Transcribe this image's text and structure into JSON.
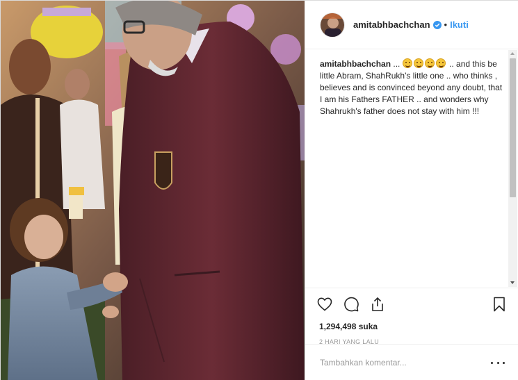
{
  "post": {
    "username": "amitabhbachchan",
    "verified": true,
    "follow_separator": "•",
    "follow_label": "Ikuti",
    "caption_user": "amitabhbachchan",
    "caption_prefix": " ... ",
    "caption_emoji_count": 4,
    "caption_text": " .. and this be little Abram, ShahRukh's little one .. who thinks , believes and is convinced beyond any doubt, that I am his Fathers FATHER .. and wonders why Shahrukh's father does not stay with him !!!",
    "likes": "1,294,498 suka",
    "timestamp": "2 HARI YANG LALU",
    "comment_placeholder": "Tambahkan komentar..."
  },
  "icons": {
    "like": "heart-icon",
    "comment": "comment-icon",
    "share": "share-icon",
    "save": "bookmark-icon",
    "verified": "verified-badge-icon",
    "more": "more-options-icon"
  },
  "colors": {
    "accent": "#3897f0",
    "text": "#262626",
    "muted": "#999999",
    "border": "#efefef",
    "emoji": "#f5c63a"
  }
}
